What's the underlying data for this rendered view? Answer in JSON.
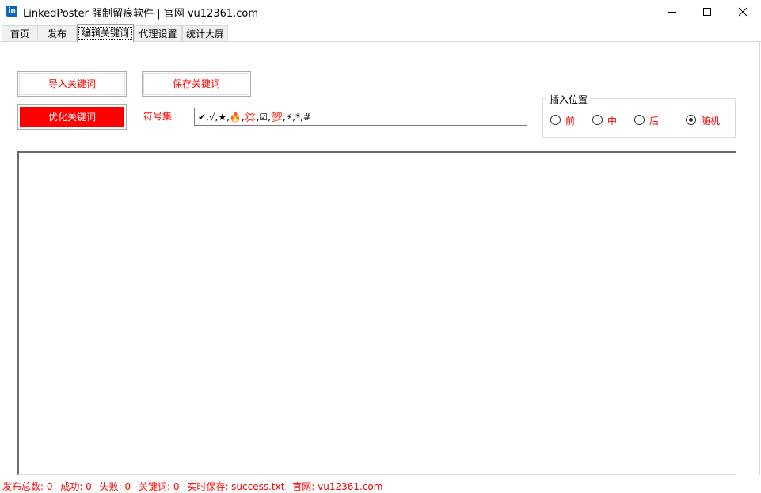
{
  "window": {
    "title": "LinkedPoster 强制留痕软件 | 官网 vu12361.com",
    "icon": "linkedin-icon",
    "icon_text": "in"
  },
  "tabs": [
    {
      "label": "首页",
      "active": false
    },
    {
      "label": "发布",
      "active": false
    },
    {
      "label": "编辑关键词",
      "active": true
    },
    {
      "label": "代理设置",
      "active": false
    },
    {
      "label": "统计大屏",
      "active": false
    }
  ],
  "toolbar": {
    "import_label": "导入关键词",
    "save_label": "保存关键词",
    "optimize_label": "优化关键词",
    "symbol_set_label": "符号集",
    "symbol_set_value": "✔,√,★,🔥,💢,☑,💯,⚡,*,#"
  },
  "insert_position": {
    "legend": "插入位置",
    "options": [
      {
        "label": "前",
        "checked": false
      },
      {
        "label": "中",
        "checked": false
      },
      {
        "label": "后",
        "checked": false
      },
      {
        "label": "随机",
        "checked": true
      }
    ]
  },
  "editor": {
    "value": ""
  },
  "status": {
    "total": "发布总数: 0",
    "success": "成功: 0",
    "failed": "失败: 0",
    "keywords": "关键词: 0",
    "autosave": "实时保存: success.txt",
    "website": "官网: vu12361.com"
  },
  "colors": {
    "accent_red": "#ff0000",
    "brand_blue": "#0a66c2"
  }
}
